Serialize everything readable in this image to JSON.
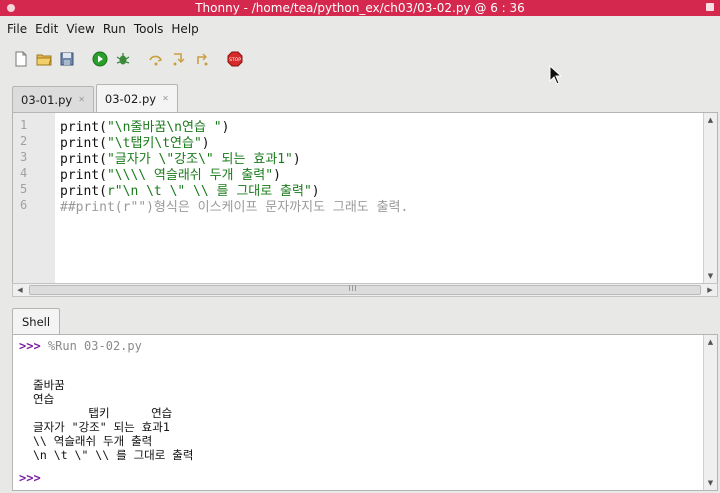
{
  "window": {
    "title": "Thonny  -  /home/tea/python_ex/ch03/03-02.py  @  6 : 36"
  },
  "menu": [
    "File",
    "Edit",
    "View",
    "Run",
    "Tools",
    "Help"
  ],
  "toolbar": [
    {
      "icon": "new-file-icon"
    },
    {
      "icon": "open-folder-icon"
    },
    {
      "icon": "save-icon"
    },
    {
      "icon": "run-icon"
    },
    {
      "icon": "debug-icon"
    },
    {
      "icon": "step-over-icon"
    },
    {
      "icon": "step-into-icon"
    },
    {
      "icon": "step-out-icon"
    },
    {
      "icon": "stop-icon",
      "label": "STOP"
    }
  ],
  "tabs": [
    {
      "label": "03-01.py",
      "active": false
    },
    {
      "label": "03-02.py",
      "active": true
    }
  ],
  "editor": {
    "line_numbers": [
      "1",
      "2",
      "3",
      "4",
      "5",
      "6"
    ],
    "lines": [
      {
        "pre": "print(",
        "str": "\"\\n줄바꿈\\n연습 \"",
        "post": ")"
      },
      {
        "pre": "print(",
        "str": "\"\\t탭키\\t연습\"",
        "post": ")"
      },
      {
        "pre": "print(",
        "str": "\"글자가 \\\"강조\\\" 되는 효과1\"",
        "post": ")"
      },
      {
        "pre": "print(",
        "str": "\"\\\\\\\\ 역슬래쉬 두개 출력\"",
        "post": ")"
      },
      {
        "pre": "print(",
        "str": "r\"\\n \\t \\\" \\\\ 를 그대로 출력\"",
        "post": ")"
      },
      {
        "comment": "##print(r\"\")형식은 이스케이프 문자까지도 그래도 출력."
      }
    ]
  },
  "shell": {
    "tab_label": "Shell",
    "prompt": ">>>",
    "command": "%Run 03-02.py",
    "output": [
      "",
      "줄바꿈",
      "연습",
      "        탭키      연습",
      "글자가 \"강조\" 되는 효과1",
      "\\\\ 역슬래쉬 두개 출력",
      "\\n \\t \\\" \\\\ 를 그대로 출력"
    ]
  },
  "colors": {
    "titlebar": "#d4284e",
    "string": "#1a7a1a",
    "comment": "#9a9a9a",
    "prompt": "#7a1fa0"
  }
}
